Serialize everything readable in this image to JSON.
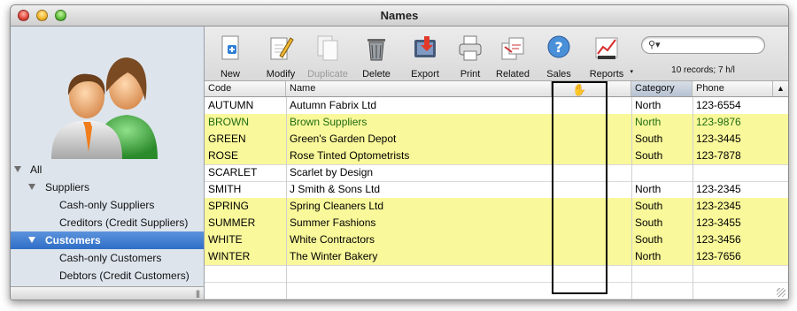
{
  "window": {
    "title": "Names"
  },
  "sidebar": {
    "tree": [
      {
        "label": "All",
        "level": 0,
        "expanded": true,
        "selected": false
      },
      {
        "label": "Suppliers",
        "level": 1,
        "expanded": true,
        "selected": false
      },
      {
        "label": "Cash-only Suppliers",
        "level": 2,
        "selected": false
      },
      {
        "label": "Creditors (Credit Suppliers)",
        "level": 2,
        "selected": false
      },
      {
        "label": "Customers",
        "level": 1,
        "expanded": true,
        "selected": true
      },
      {
        "label": "Cash-only Customers",
        "level": 2,
        "selected": false
      },
      {
        "label": "Debtors (Credit Customers)",
        "level": 2,
        "selected": false
      }
    ],
    "grip": "|||"
  },
  "toolbar": {
    "buttons": [
      {
        "label": "New",
        "icon": "new-document-icon",
        "enabled": true
      },
      {
        "label": "Modify",
        "icon": "modify-pencil-icon",
        "enabled": true
      },
      {
        "label": "Duplicate",
        "icon": "duplicate-icon",
        "enabled": false
      },
      {
        "label": "Delete",
        "icon": "trash-icon",
        "enabled": true
      },
      {
        "label": "Export",
        "icon": "export-icon",
        "enabled": true
      },
      {
        "label": "Print",
        "icon": "printer-icon",
        "enabled": true
      },
      {
        "label": "Related",
        "icon": "related-icon",
        "enabled": true
      },
      {
        "label": "Sales",
        "icon": "help-bubble-icon",
        "enabled": true
      },
      {
        "label": "Reports",
        "icon": "reports-chart-icon",
        "enabled": true
      }
    ],
    "search": {
      "placeholder": "",
      "icon": "search-icon"
    },
    "record_count": "10 records; 7 h/l"
  },
  "table": {
    "columns": [
      "Code",
      "Name",
      "",
      "",
      "Category",
      "Phone"
    ],
    "sorted_column": "Category",
    "rows": [
      {
        "code": "AUTUMN",
        "name": "Autumn Fabrix Ltd",
        "category": "North",
        "phone": "123-6554",
        "highlight": false,
        "text_color": "#000000"
      },
      {
        "code": "BROWN",
        "name": "Brown Suppliers",
        "category": "North",
        "phone": "123-9876",
        "highlight": true,
        "text_color": "#1f6b12"
      },
      {
        "code": "GREEN",
        "name": "Green's Garden Depot",
        "category": "South",
        "phone": "123-3445",
        "highlight": true,
        "text_color": "#000000"
      },
      {
        "code": "ROSE",
        "name": "Rose Tinted Optometrists",
        "category": "South",
        "phone": "123-7878",
        "highlight": true,
        "text_color": "#000000"
      },
      {
        "code": "SCARLET",
        "name": "Scarlet by Design",
        "category": "",
        "phone": "",
        "highlight": false,
        "text_color": "#000000"
      },
      {
        "code": "SMITH",
        "name": "J Smith & Sons Ltd",
        "category": "North",
        "phone": "123-2345",
        "highlight": false,
        "text_color": "#000000"
      },
      {
        "code": "SPRING",
        "name": "Spring Cleaners Ltd",
        "category": "South",
        "phone": "123-2345",
        "highlight": true,
        "text_color": "#000000"
      },
      {
        "code": "SUMMER",
        "name": "Summer Fashions",
        "category": "South",
        "phone": "123-3455",
        "highlight": true,
        "text_color": "#000000"
      },
      {
        "code": "WHITE",
        "name": "White Contractors",
        "category": "South",
        "phone": "123-3456",
        "highlight": true,
        "text_color": "#000000"
      },
      {
        "code": "WINTER",
        "name": "The Winter Bakery",
        "category": "North",
        "phone": "123-7656",
        "highlight": true,
        "text_color": "#000000"
      }
    ]
  },
  "colors": {
    "highlight": "#f9f89a",
    "selection": "#3a78cc"
  }
}
